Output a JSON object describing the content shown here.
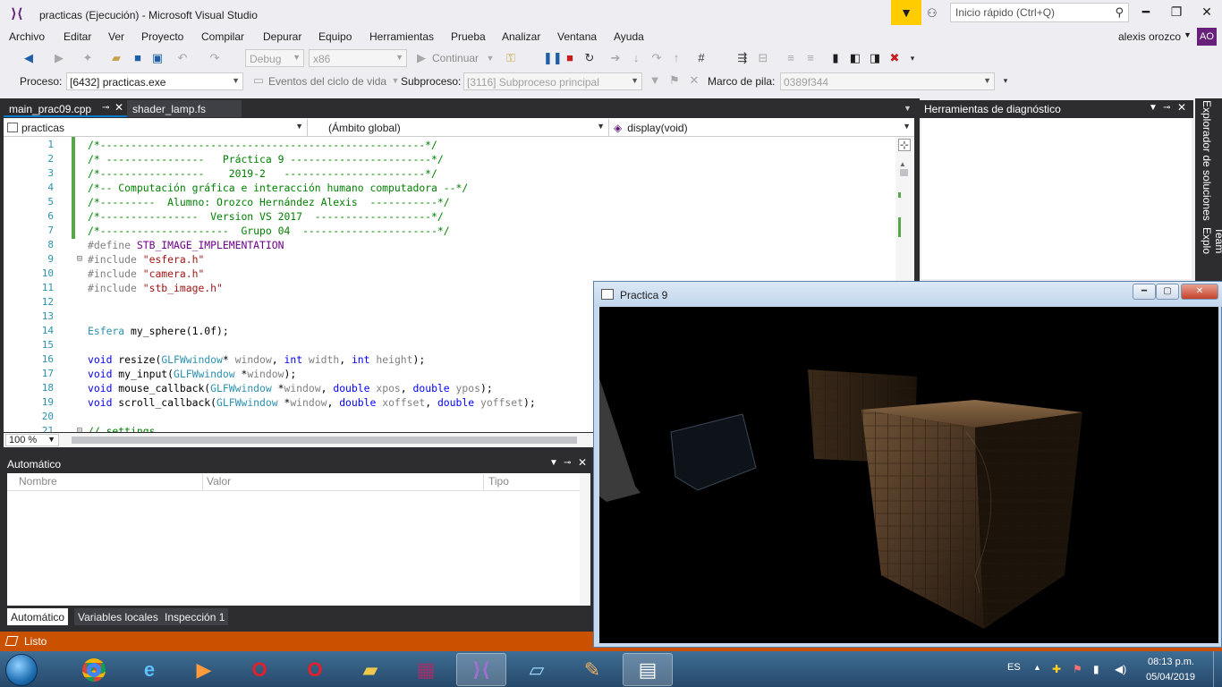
{
  "window": {
    "title": "practicas (Ejecución) - Microsoft Visual Studio"
  },
  "quick_launch": {
    "placeholder": "Inicio rápido (Ctrl+Q)"
  },
  "menu": [
    "Archivo",
    "Editar",
    "Ver",
    "Proyecto",
    "Compilar",
    "Depurar",
    "Equipo",
    "Herramientas",
    "Prueba",
    "Analizar",
    "Ventana",
    "Ayuda"
  ],
  "user": {
    "name": "alexis orozco",
    "initials": "AO"
  },
  "toolbar": {
    "config": "Debug",
    "platform": "x86",
    "continue_label": "Continuar"
  },
  "location_bar": {
    "process_label": "Proceso:",
    "process_value": "[6432] practicas.exe",
    "lifecycle_label": "Eventos del ciclo de vida",
    "thread_label": "Subproceso:",
    "thread_value": "[3116] Subproceso principal",
    "stack_label": "Marco de pila:",
    "stack_value": "0389f344"
  },
  "tabs": [
    {
      "label": "main_prac09.cpp",
      "active": true
    },
    {
      "label": "shader_lamp.fs",
      "active": false
    }
  ],
  "nav": {
    "project": "practicas",
    "scope": "(Ámbito global)",
    "member": "display(void)"
  },
  "code_lines": [
    "1",
    "2",
    "3",
    "4",
    "5",
    "6",
    "7",
    "8",
    "9",
    "10",
    "11",
    "12",
    "13",
    "14",
    "15",
    "16",
    "17",
    "18",
    "19",
    "20",
    "21"
  ],
  "code": {
    "l1": "/*-----------------------------------------------------*/",
    "l2": "/* ----------------   Práctica 9 -----------------------*/",
    "l3": "/*-----------------    2019-2   -----------------------*/",
    "l4": "/*-- Computación gráfica e interacción humano computadora --*/",
    "l5": "/*---------  Alumno: Orozco Hernández Alexis  -----------*/",
    "l6": "/*----------------  Version VS 2017  -------------------*/",
    "l7": "/*---------------------  Grupo 04  ----------------------*/",
    "l8_pp": "#define",
    "l8_id": "STB_IMAGE_IMPLEMENTATION",
    "include_kw": "#include",
    "inc1": "\"esfera.h\"",
    "inc2": "\"camera.h\"",
    "inc3": "\"stb_image.h\"",
    "l14_ty": "Esfera",
    "l14_rest": " my_sphere(1.0f);",
    "void_kw": "void",
    "glfw_ty": "GLFWwindow",
    "int_kw": "int",
    "double_kw": "double",
    "l16_fn": " resize(",
    "l16_ptr": "* ",
    "l16_win": "window",
    "l16_sep1": ", ",
    "l16_w": " width",
    "l16_sep2": ", ",
    "l16_h": " height",
    "l16_end": ");",
    "l17_fn": " my_input(",
    "l17_ptr": " *",
    "l17_win": "window",
    "l17_end": ");",
    "l18_fn": " mouse_callback(",
    "l18_ptr": " *",
    "l18_win": "window",
    "l18_sep1": ", ",
    "l18_x": " xpos",
    "l18_sep2": ", ",
    "l18_y": " ypos",
    "l18_end": ");",
    "l19_fn": " scroll_callback(",
    "l19_ptr": " *",
    "l19_win": "window",
    "l19_sep1": ", ",
    "l19_x": " xoffset",
    "l19_sep2": ", ",
    "l19_y": " yoffset",
    "l19_end": ");",
    "l21": "// settings"
  },
  "zoom": "100 %",
  "autos": {
    "title": "Automático",
    "columns": [
      "Nombre",
      "Valor",
      "Tipo"
    ],
    "tabs": [
      "Automático",
      "Variables locales",
      "Inspección 1"
    ]
  },
  "diagnostics": {
    "title": "Herramientas de diagnóstico"
  },
  "side_panels": [
    "Explorador de soluciones",
    "Team Explo"
  ],
  "status": {
    "text": "Listo"
  },
  "gl_window": {
    "title": "Practica 9"
  },
  "tray": {
    "lang": "ES",
    "time": "08:13 p.m.",
    "date": "05/04/2019"
  },
  "colors": {
    "status_bar": "#ca5100",
    "accent": "#007acc",
    "vs_purple": "#68217a",
    "comment": "#008000",
    "keyword": "#0000ff",
    "type": "#2b91af",
    "string": "#a31515"
  }
}
